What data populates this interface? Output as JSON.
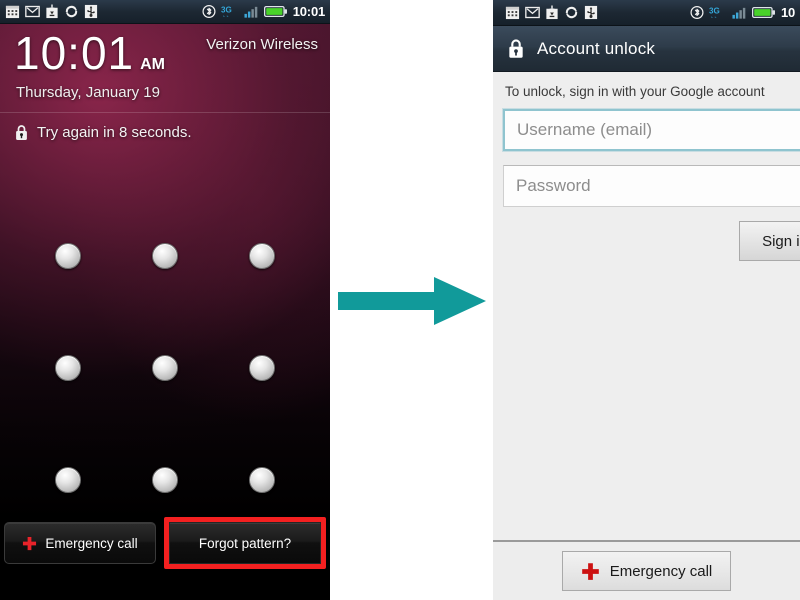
{
  "left_phone": {
    "statusbar": {
      "icons": [
        "calendar-icon",
        "gmail-icon",
        "download-icon",
        "sync-icon",
        "usb-icon",
        "bluetooth-icon",
        "network-3g-icon",
        "signal-bars-icon",
        "battery-icon"
      ],
      "network_label": "3G",
      "clock": "10:01"
    },
    "lockscreen": {
      "time": "10:01",
      "ampm": "AM",
      "carrier": "Verizon Wireless",
      "date": "Thursday, January 19",
      "status_message": "Try again in 8 seconds.",
      "lock_icon": "lock-icon",
      "pattern_dots": 9,
      "emergency_call_label": "Emergency call",
      "forgot_pattern_label": "Forgot pattern?",
      "highlight_color": "#f32020",
      "emergency_cross_color": "#e8232a"
    }
  },
  "arrow": {
    "name": "flow-arrow",
    "color": "#119a9a",
    "direction": "right"
  },
  "right_phone": {
    "statusbar": {
      "icons": [
        "calendar-icon",
        "gmail-icon",
        "download-icon",
        "sync-icon",
        "usb-icon",
        "bluetooth-icon",
        "network-3g-icon",
        "signal-bars-icon",
        "battery-icon"
      ],
      "network_label": "3G",
      "clock": "10"
    },
    "titlebar": {
      "lock_icon": "lock-icon",
      "title": "Account unlock"
    },
    "form": {
      "instruction": "To unlock, sign in with your Google account",
      "username_placeholder": "Username (email)",
      "username_value": "",
      "password_placeholder": "Password",
      "password_value": "",
      "signin_label": "Sign in",
      "focus_border_color": "#8fc4cf"
    },
    "bottom": {
      "emergency_call_label": "Emergency call",
      "emergency_cross_color": "#cc1111"
    }
  }
}
